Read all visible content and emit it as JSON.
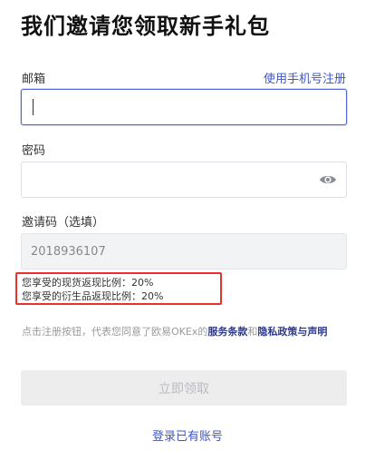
{
  "page": {
    "title": "我们邀请您领取新手礼包"
  },
  "email": {
    "label": "邮箱",
    "value": "",
    "placeholder": ""
  },
  "phone_register_link": "使用手机号注册",
  "password": {
    "label": "密码",
    "value": "",
    "placeholder": ""
  },
  "invite": {
    "label": "邀请码（选填）",
    "value": "2018936107"
  },
  "rebate": {
    "spot": "您享受的现货返现比例：20%",
    "derivatives": "您享受的衍生品返现比例：20%"
  },
  "agreement": {
    "prefix": "点击注册按钮，代表您同意了欧易OKEx的",
    "terms": "服务条款",
    "conj": "和",
    "privacy": "隐私政策与声明"
  },
  "submit_label": "立即领取",
  "login_link": "登录已有账号",
  "colors": {
    "accent": "#3e57c4",
    "highlight_border": "#e5322d",
    "disabled_button": "#ededee"
  },
  "icons": {
    "password_toggle": "eye-icon"
  }
}
